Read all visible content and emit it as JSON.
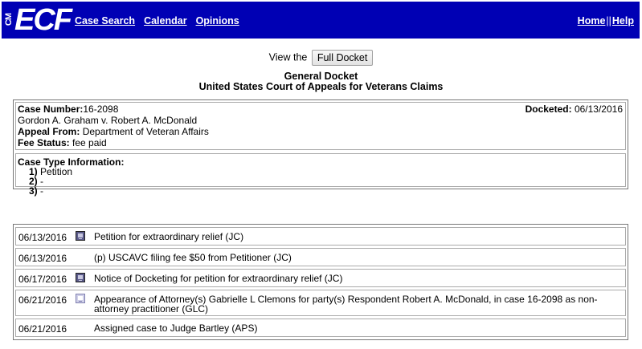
{
  "header": {
    "logo_cm": "CM",
    "logo_ecf": "ECF",
    "nav": [
      "Case Search",
      "Calendar",
      "Opinions"
    ],
    "home": "Home",
    "separator": "||",
    "help": "Help"
  },
  "view": {
    "prefix": "View the",
    "button": "Full Docket"
  },
  "titles": {
    "line1": "General Docket",
    "line2": "United States Court of Appeals for Veterans Claims"
  },
  "case": {
    "number_label": "Case Number:",
    "number": "16-2098",
    "docketed_label": "Docketed:",
    "docketed": "06/13/2016",
    "parties": "Gordon A. Graham v. Robert A. McDonald",
    "appeal_label": "Appeal From:",
    "appeal": "Department of Veteran Affairs",
    "fee_label": "Fee Status:",
    "fee": "fee paid"
  },
  "case_type": {
    "label": "Case Type Information:",
    "items": [
      {
        "num": "1)",
        "text": "Petition"
      },
      {
        "num": "2)",
        "text": "-"
      },
      {
        "num": "3)",
        "text": "-"
      }
    ]
  },
  "entries": [
    {
      "date": "06/13/2016",
      "icon": "document-icon",
      "text": "Petition for extraordinary relief (JC)"
    },
    {
      "date": "06/13/2016",
      "icon": "",
      "text": "(p) USCAVC filing fee $50 from Petitioner (JC)"
    },
    {
      "date": "06/17/2016",
      "icon": "document-icon",
      "text": "Notice of Docketing for petition for extraordinary relief (JC)"
    },
    {
      "date": "06/21/2016",
      "icon": "document-icon-light",
      "text": "Appearance of Attorney(s) Gabrielle L Clemons for party(s) Respondent Robert A. McDonald, in case 16-2098 as non-attorney practitioner (GLC)"
    },
    {
      "date": "06/21/2016",
      "icon": "",
      "text": "Assigned case to Judge Bartley (APS)"
    }
  ]
}
